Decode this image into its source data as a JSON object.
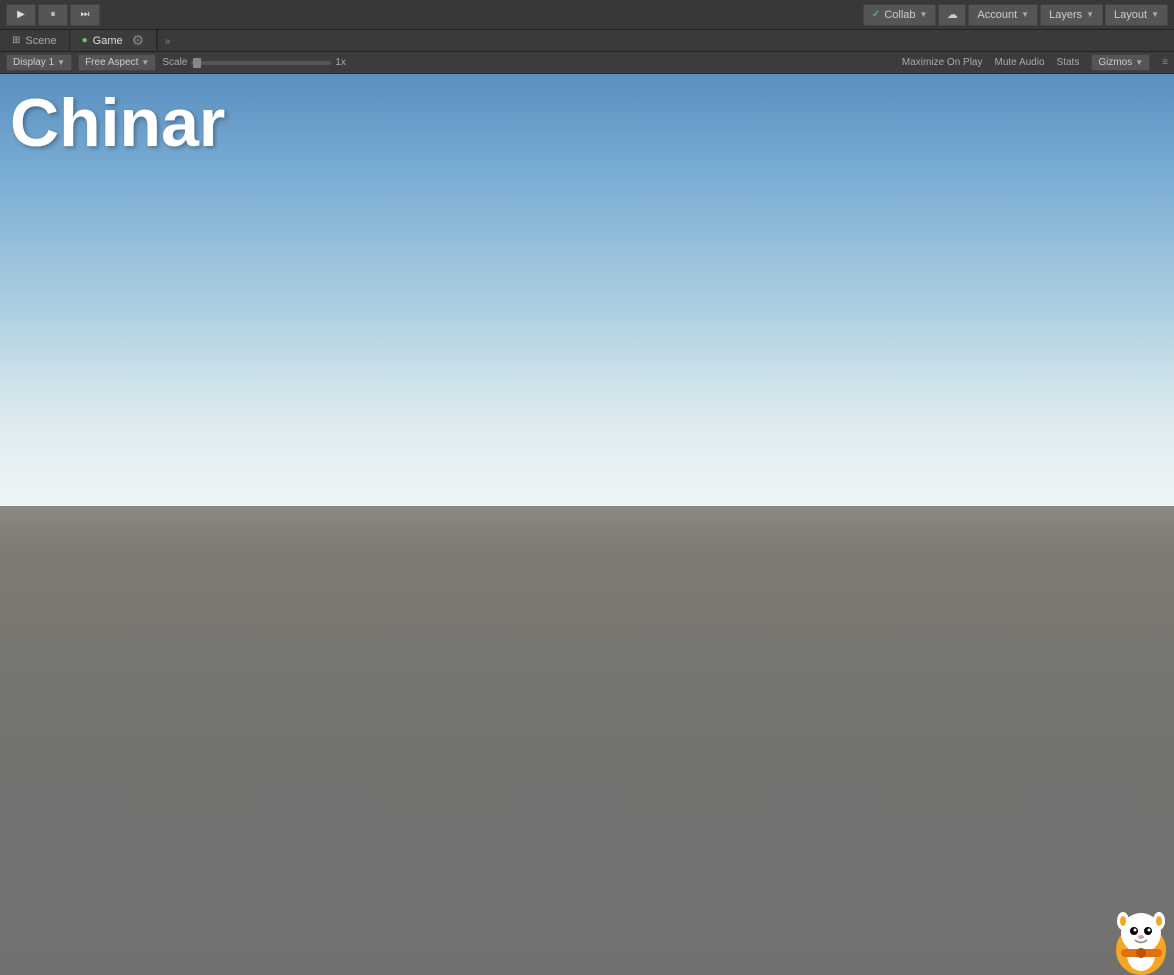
{
  "toolbar": {
    "play_label": "▶",
    "pause_label": "⏸",
    "step_label": "⏭",
    "collab_label": "Collab",
    "account_label": "Account",
    "layers_label": "Layers",
    "layout_label": "Layout"
  },
  "tabs": {
    "scene_label": "Scene",
    "game_label": "Game",
    "scene_icon": "⊞",
    "game_icon": "●"
  },
  "game_toolbar": {
    "display_label": "Display 1",
    "aspect_label": "Free Aspect",
    "scale_label": "Scale",
    "scale_value": "1x",
    "maximize_label": "Maximize On Play",
    "mute_label": "Mute Audio",
    "stats_label": "Stats",
    "gizmos_label": "Gizmos"
  },
  "game_view": {
    "title": "Chinar"
  },
  "colors": {
    "toolbar_bg": "#383838",
    "tab_active_bg": "#3c3c3c",
    "sky_top": "#5a8fbf",
    "sky_bottom": "#f0f6f8",
    "ground": "#737270",
    "accent_green": "#6c6"
  }
}
